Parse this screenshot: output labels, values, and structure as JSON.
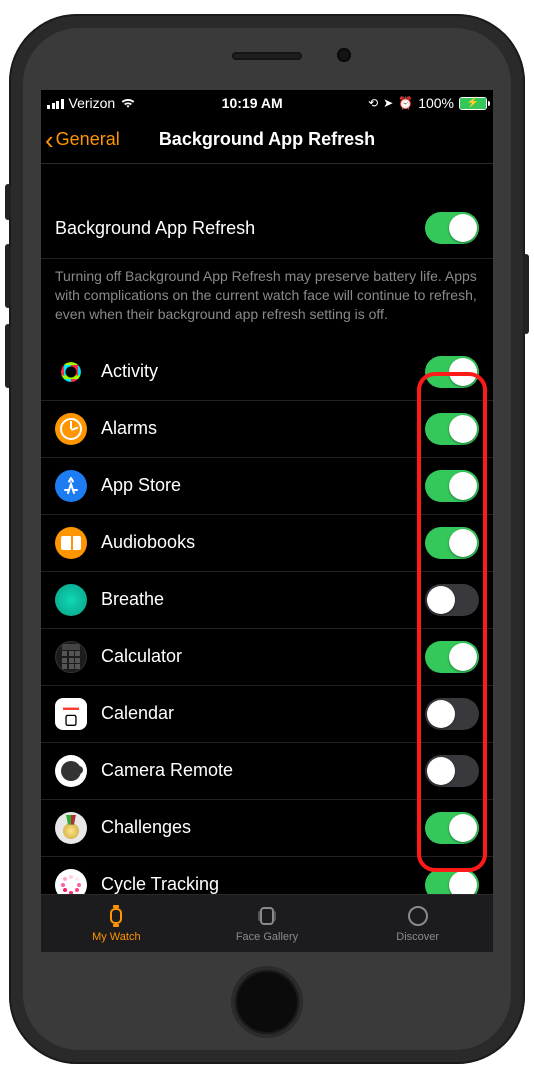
{
  "status": {
    "carrier": "Verizon",
    "time": "10:19 AM",
    "battery_pct": "100%"
  },
  "nav": {
    "back_label": "General",
    "title": "Background App Refresh"
  },
  "master": {
    "label": "Background App Refresh",
    "enabled": true
  },
  "description": "Turning off Background App Refresh may preserve battery life. Apps with complications on the current watch face will continue to refresh, even when their background app refresh setting is off.",
  "apps": [
    {
      "name": "Activity",
      "icon": "activity",
      "enabled": true
    },
    {
      "name": "Alarms",
      "icon": "alarms",
      "enabled": true
    },
    {
      "name": "App Store",
      "icon": "appstore",
      "enabled": true
    },
    {
      "name": "Audiobooks",
      "icon": "audiobooks",
      "enabled": true
    },
    {
      "name": "Breathe",
      "icon": "breathe",
      "enabled": false
    },
    {
      "name": "Calculator",
      "icon": "calculator",
      "enabled": true
    },
    {
      "name": "Calendar",
      "icon": "calendar",
      "enabled": false
    },
    {
      "name": "Camera Remote",
      "icon": "camera",
      "enabled": false
    },
    {
      "name": "Challenges",
      "icon": "challenges",
      "enabled": true
    },
    {
      "name": "Cycle Tracking",
      "icon": "cycle",
      "enabled": true
    }
  ],
  "tabs": [
    {
      "label": "My Watch",
      "icon": "watch",
      "active": true
    },
    {
      "label": "Face Gallery",
      "icon": "gallery",
      "active": false
    },
    {
      "label": "Discover",
      "icon": "compass",
      "active": false
    }
  ]
}
